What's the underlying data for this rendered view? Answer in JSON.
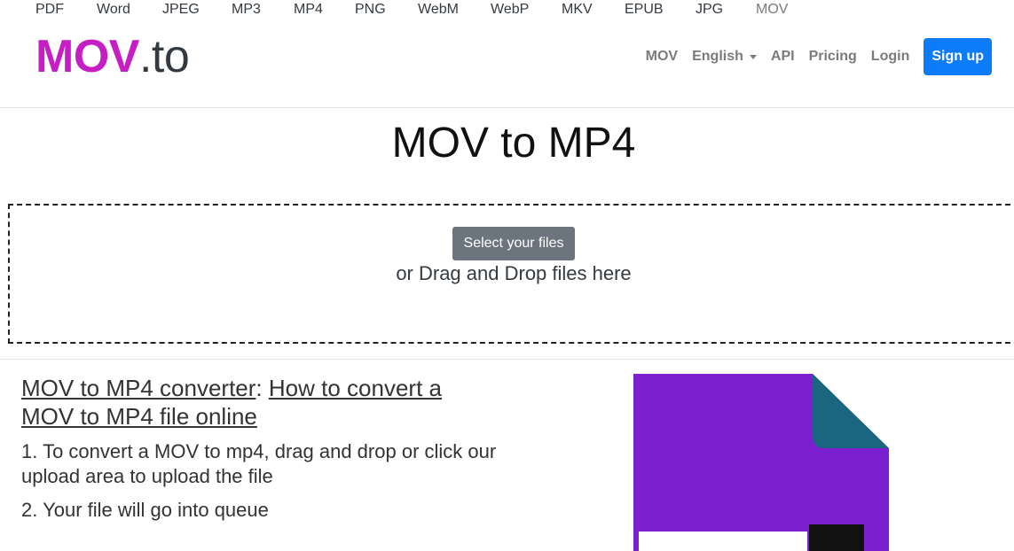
{
  "formats": [
    "PDF",
    "Word",
    "JPEG",
    "MP3",
    "MP4",
    "PNG",
    "WebM",
    "WebP",
    "MKV",
    "EPUB",
    "JPG",
    "MOV"
  ],
  "logo": {
    "primary": "MOV",
    "suffix": ".to"
  },
  "nav": {
    "mov": "MOV",
    "language": "English",
    "api": "API",
    "pricing": "Pricing",
    "login": "Login",
    "signup": "Sign up"
  },
  "title": "MOV to MP4",
  "upload": {
    "button": "Select your files",
    "hint": "or Drag and Drop files here"
  },
  "howto": {
    "link1": "MOV to MP4 converter",
    "sep": ":",
    "link2": "How to convert a MOV to MP4 file online",
    "steps": [
      "1. To convert a MOV to mp4, drag and drop or click our upload area to upload the file",
      "2. Your file will go into queue"
    ]
  },
  "colors": {
    "brand_magenta": "#c51ec5",
    "signup_blue": "#0d7cfb",
    "doc_purple": "#7b1fcf",
    "doc_fold": "#1a6580"
  }
}
